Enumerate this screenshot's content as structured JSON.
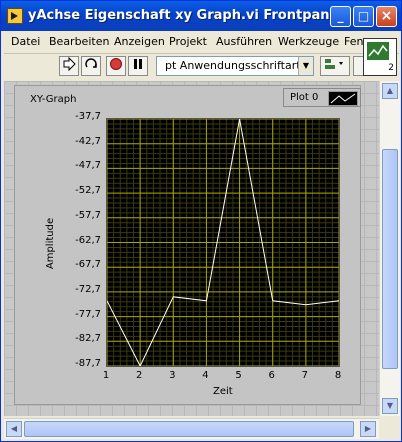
{
  "window": {
    "title": "yAchse Eigenschaft xy Graph.vi Frontpanel",
    "minimize_label": "_",
    "maximize_label": "□",
    "close_label": "×"
  },
  "menu": {
    "items": [
      {
        "label": "Datei"
      },
      {
        "label": "Bearbeiten"
      },
      {
        "label": "Anzeigen"
      },
      {
        "label": "Projekt"
      },
      {
        "label": "Ausführen"
      },
      {
        "label": "Werkzeuge"
      },
      {
        "label": "Fen"
      }
    ]
  },
  "toolbar": {
    "font_selector_value": "pt Anwendungsschriftart",
    "icons": [
      "run-arrow-icon",
      "run-continuously-icon",
      "abort-icon",
      "pause-icon",
      "align-icon",
      "distribute-icon"
    ]
  },
  "vi_icon": {
    "number": "2"
  },
  "graph": {
    "label": "XY-Graph",
    "legend_plot_name": "Plot 0",
    "background_color": "#000000",
    "grid_color": "#a4a400",
    "plot_color": "#ffffff"
  },
  "chart_data": {
    "type": "line",
    "title": "",
    "xlabel": "Zeit",
    "ylabel": "Amplitude",
    "x": [
      1,
      2,
      3,
      4,
      5,
      6,
      7,
      8
    ],
    "series": [
      {
        "name": "Plot 0",
        "values": [
          -74.5,
          -87.7,
          -73.7,
          -74.5,
          -37.7,
          -74.5,
          -75.3,
          -74.5
        ]
      }
    ],
    "xlim": [
      1,
      8
    ],
    "ylim": [
      -87.7,
      -37.7
    ],
    "x_ticks": [
      "1",
      "2",
      "3",
      "4",
      "5",
      "6",
      "7",
      "8"
    ],
    "y_ticks": [
      "-37,7",
      "-42,7",
      "-47,7",
      "-52,7",
      "-57,7",
      "-62,7",
      "-67,7",
      "-72,7",
      "-77,7",
      "-82,7",
      "-87,7"
    ],
    "grid": true,
    "legend": "top-right"
  }
}
